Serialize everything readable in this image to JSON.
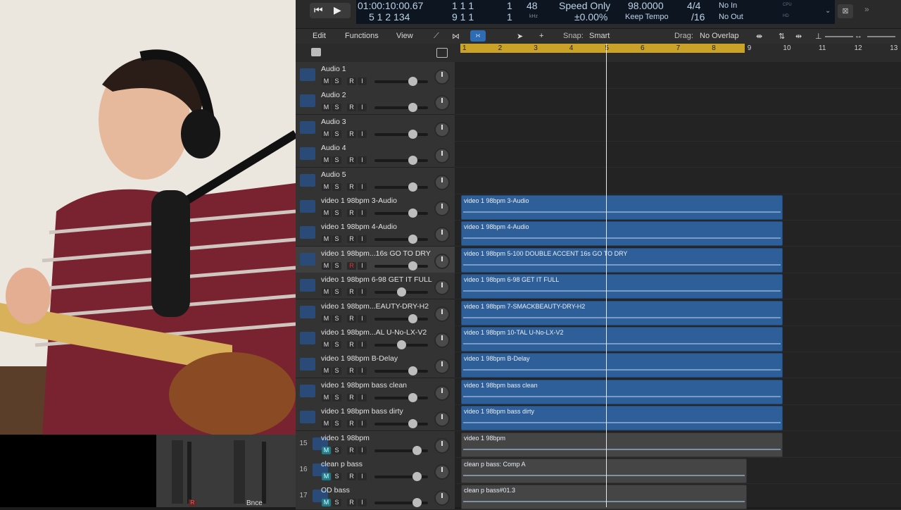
{
  "control_bar": {
    "position_time": "01:00:10:00.67",
    "position_bars": "5 1 2 134",
    "end_top": "1 1 1",
    "end_bottom": "9 1 1",
    "end_top_last": "1",
    "end_bottom_last": "1",
    "bpm_top": "48",
    "bpm_sub": "kHz",
    "speed_mode": "Speed Only",
    "speed_value": "±0.00%",
    "tempo_value": "98.0000",
    "tempo_mode": "Keep Tempo",
    "time_sig": "4/4",
    "division": "/16",
    "in_label": "No In",
    "out_label": "No Out",
    "cpu_label": "CPU",
    "hd_label": "HD"
  },
  "toolbar": {
    "edit": "Edit",
    "functions": "Functions",
    "view": "View",
    "snap_label": "Snap:",
    "snap_value": "Smart",
    "drag_label": "Drag:",
    "drag_value": "No Overlap"
  },
  "ruler": {
    "bars": [
      "1",
      "2",
      "3",
      "4",
      "5",
      "6",
      "7",
      "8",
      "9",
      "10",
      "11",
      "12",
      "13"
    ]
  },
  "tracks": [
    {
      "num": "",
      "name": "Audio 1"
    },
    {
      "num": "",
      "name": "Audio 2"
    },
    {
      "num": "",
      "name": "Audio 3"
    },
    {
      "num": "",
      "name": "Audio 4"
    },
    {
      "num": "",
      "name": "Audio 5"
    },
    {
      "num": "",
      "name": "video 1 98bpm 3-Audio"
    },
    {
      "num": "",
      "name": "video 1 98bpm 4-Audio"
    },
    {
      "num": "",
      "name": "video 1 98bpm...16s GO TO DRY"
    },
    {
      "num": "",
      "name": "video 1 98bpm 6-98 GET IT FULL"
    },
    {
      "num": "",
      "name": "video 1 98bpm...EAUTY-DRY-H2"
    },
    {
      "num": "",
      "name": "video 1 98bpm...AL U-No-LX-V2"
    },
    {
      "num": "",
      "name": "video 1 98bpm B-Delay"
    },
    {
      "num": "",
      "name": "video 1 98bpm bass clean"
    },
    {
      "num": "",
      "name": "video 1 98bpm bass dirty"
    },
    {
      "num": "15",
      "name": "video 1 98bpm"
    },
    {
      "num": "16",
      "name": "clean p bass"
    },
    {
      "num": "17",
      "name": "OD bass"
    }
  ],
  "buttons": {
    "m": "M",
    "s": "S",
    "r": "R",
    "i": "I"
  },
  "regions": [
    {
      "lane": 5,
      "name": "video 1 98bpm 3-Audio"
    },
    {
      "lane": 6,
      "name": "video 1 98bpm 4-Audio"
    },
    {
      "lane": 7,
      "name": "video 1 98bpm 5-100 DOUBLE ACCENT 16s GO TO DRY"
    },
    {
      "lane": 8,
      "name": "video 1 98bpm 6-98 GET IT FULL"
    },
    {
      "lane": 9,
      "name": "video 1 98bpm 7-SMACKBEAUTY-DRY-H2"
    },
    {
      "lane": 10,
      "name": "video 1 98bpm 10-TAL U-No-LX-V2"
    },
    {
      "lane": 11,
      "name": "video 1 98bpm B-Delay"
    },
    {
      "lane": 12,
      "name": "video 1 98bpm bass clean"
    },
    {
      "lane": 13,
      "name": "video 1 98bpm bass dirty"
    },
    {
      "lane": 14,
      "name": "video 1 98bpm"
    },
    {
      "lane": 15,
      "name": "clean p bass: Comp A"
    },
    {
      "lane": 16,
      "name": "clean p bass#01.3"
    }
  ],
  "mixer": {
    "bounce_label": "Bnce"
  }
}
